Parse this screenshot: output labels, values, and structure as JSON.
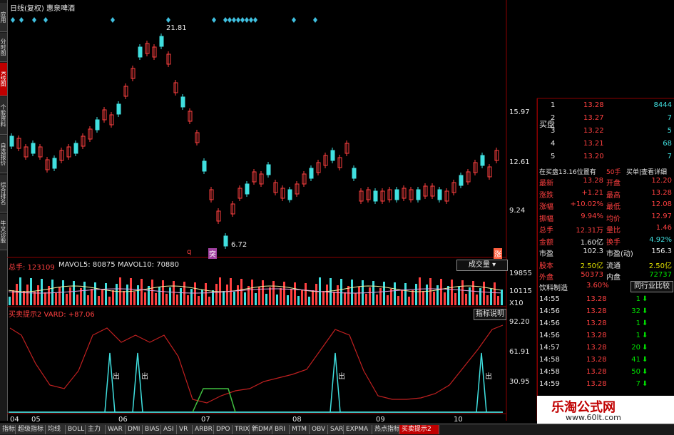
{
  "window": {
    "title": "日线(复权) 惠泉啤酒"
  },
  "price_panel": {
    "high_label": "21.81",
    "low_label": "6.72",
    "marker_q": "q",
    "marker_tu": "突",
    "marker_zhang": "涨",
    "scale": [
      "15.97",
      "12.61",
      "9.24"
    ]
  },
  "volume_panel": {
    "total": "总手: 123109",
    "ma5": "MAVOL5: 80875",
    "ma10": "MAVOL10: 70880",
    "selector": "成交量",
    "scale": [
      "19855",
      "10115",
      "X10"
    ]
  },
  "indicator_panel": {
    "name": "买卖提示2 VARD: +87.06",
    "explain_button": "指标说明",
    "chu_label": "出",
    "scale": [
      "92.20",
      "61.91",
      "30.95"
    ]
  },
  "x_axis": [
    "04",
    "05",
    "06",
    "07",
    "08",
    "09",
    "10"
  ],
  "order_book": {
    "sell_label": "买盘",
    "rows": [
      {
        "level": "1",
        "price": "13.28",
        "vol": "8444"
      },
      {
        "level": "2",
        "price": "13.27",
        "vol": "7"
      },
      {
        "level": "3",
        "price": "13.22",
        "vol": "5"
      },
      {
        "level": "4",
        "price": "13.21",
        "vol": "68"
      },
      {
        "level": "5",
        "price": "13.20",
        "vol": "7"
      }
    ],
    "status": "在买盘13.16位置有",
    "status_count": "50手",
    "status_link": "买单|查看详细"
  },
  "quote": [
    {
      "l": "最新",
      "v": "13.28",
      "r": "开盘",
      "rv": "12.20"
    },
    {
      "l": "涨跌",
      "v": "+1.21",
      "r": "最高",
      "rv": "13.28"
    },
    {
      "l": "涨幅",
      "v": "+10.02%",
      "r": "最低",
      "rv": "12.08"
    },
    {
      "l": "振幅",
      "v": "9.94%",
      "r": "均价",
      "rv": "12.97"
    },
    {
      "l": "总手",
      "v": "12.31万",
      "r": "量比",
      "rv": "1.46"
    },
    {
      "l": "金额",
      "v": "1.60亿",
      "r": "换手",
      "rv": "4.92%"
    },
    {
      "l": "市盈",
      "v": "102.3",
      "r": "市盈(动)",
      "rv": "156.3"
    },
    {
      "l": "股本",
      "v": "2.50亿",
      "r": "流通",
      "rv": "2.50亿"
    },
    {
      "l": "外盘",
      "v": "50373",
      "r": "内盘",
      "rv": "72737"
    }
  ],
  "industry": {
    "name": "饮料制造",
    "pct": "3.60%",
    "button": "同行业比较"
  },
  "ticks": [
    {
      "t": "14:55",
      "p": "13.28",
      "v": "1"
    },
    {
      "t": "14:56",
      "p": "13.28",
      "v": "32"
    },
    {
      "t": "14:56",
      "p": "13.28",
      "v": "1"
    },
    {
      "t": "14:56",
      "p": "13.28",
      "v": "1"
    },
    {
      "t": "14:57",
      "p": "13.28",
      "v": "20"
    },
    {
      "t": "14:58",
      "p": "13.28",
      "v": "41"
    },
    {
      "t": "14:58",
      "p": "13.28",
      "v": "50"
    },
    {
      "t": "14:59",
      "p": "13.28",
      "v": "7"
    }
  ],
  "left_tabs": [
    "应用",
    "分时图",
    "K线图",
    "个股资料",
    "自选报价",
    "综合排名",
    "牛叉诊股"
  ],
  "bottom_tabs": [
    "指标",
    "超级指标",
    "均线",
    "BOLL",
    "主力",
    "WAR",
    "DMI",
    "BIAS",
    "ASI",
    "VR",
    "ARBR",
    "DPO",
    "TRIX",
    "新DMA",
    "BRI",
    "MTM",
    "OBV",
    "SAR",
    "EXPMA",
    "热点指标",
    "买卖提示2"
  ],
  "watermark": {
    "line1": "乐淘公式网",
    "line2": "www.60lt.com"
  },
  "colors": {
    "up": "#ff4040",
    "down": "#40e0e0",
    "border": "#8b0000"
  }
}
